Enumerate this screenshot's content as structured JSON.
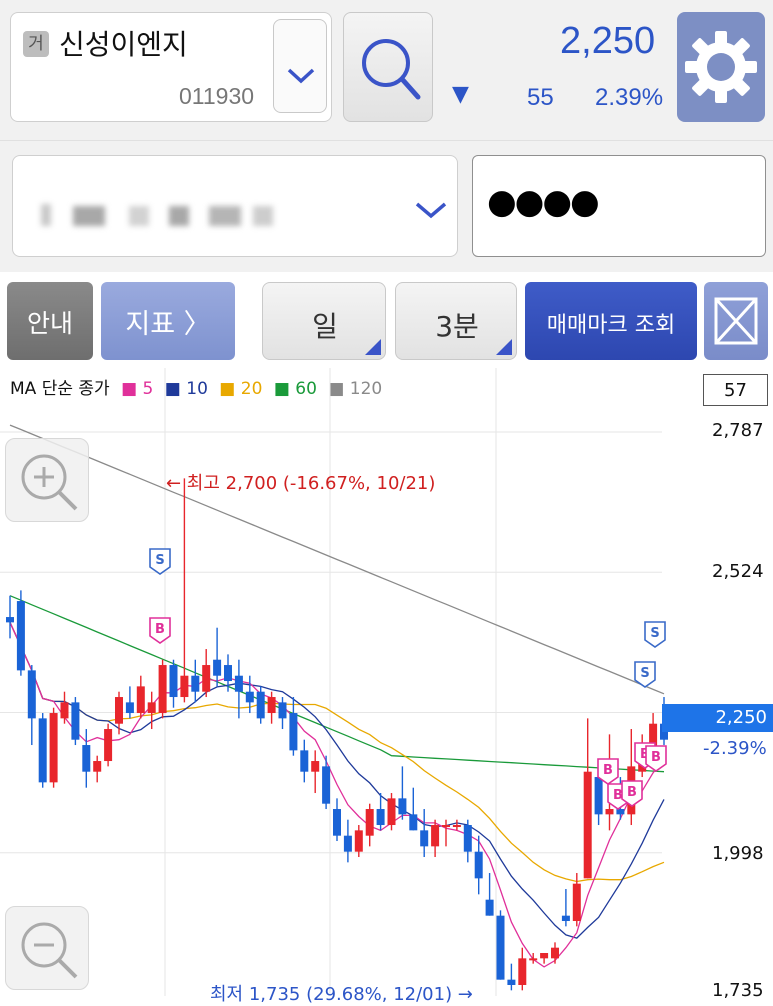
{
  "stock": {
    "market_badge": "거",
    "name": "신성이엔지",
    "code": "011930",
    "price": "2,250",
    "change_arrow": "▼",
    "change": "55",
    "change_pct": "2.39%"
  },
  "account": {
    "password_mask": "●●●●"
  },
  "toolbar": {
    "guide": "안내",
    "indicator": "지표 〉",
    "period": "일",
    "interval": "3분",
    "trade_mark": "매매마크 조회"
  },
  "legend": {
    "prefix": "MA 단순 종가",
    "items": [
      {
        "label": "5",
        "color": "#e0309a"
      },
      {
        "label": "10",
        "color": "#1f3a9a"
      },
      {
        "label": "20",
        "color": "#e8a800"
      },
      {
        "label": "60",
        "color": "#1a9a3a"
      },
      {
        "label": "120",
        "color": "#8a8a8a"
      }
    ],
    "count": "57"
  },
  "colors": {
    "accent": "#3a54c8",
    "up": "#e8262c",
    "down": "#1a63d6",
    "current_price_tag": "#1e74e8"
  },
  "chart_data": {
    "type": "candlestick",
    "y_ticks": [
      "2,787",
      "2,524",
      "1,998",
      "1,735"
    ],
    "ylim": [
      1735,
      2787
    ],
    "current_price": "2,250",
    "current_change": "-2.39%",
    "high_annotation": "← 최고 2,700 (-16.67%, 10/21)",
    "low_annotation": "최저 1,735 (29.68%, 12/01) →",
    "candles": [
      [
        2440,
        2480,
        2400,
        2430
      ],
      [
        2470,
        2490,
        2330,
        2340
      ],
      [
        2340,
        2350,
        2200,
        2250
      ],
      [
        2250,
        2260,
        2120,
        2130
      ],
      [
        2130,
        2270,
        2120,
        2260
      ],
      [
        2250,
        2300,
        2240,
        2280
      ],
      [
        2280,
        2290,
        2200,
        2210
      ],
      [
        2200,
        2230,
        2120,
        2150
      ],
      [
        2150,
        2180,
        2130,
        2170
      ],
      [
        2170,
        2240,
        2160,
        2230
      ],
      [
        2240,
        2300,
        2220,
        2290
      ],
      [
        2280,
        2310,
        2250,
        2260
      ],
      [
        2260,
        2330,
        2250,
        2310
      ],
      [
        2260,
        2300,
        2230,
        2280
      ],
      [
        2260,
        2360,
        2250,
        2350
      ],
      [
        2350,
        2360,
        2270,
        2290
      ],
      [
        2290,
        2700,
        2280,
        2330
      ],
      [
        2330,
        2360,
        2280,
        2300
      ],
      [
        2300,
        2380,
        2290,
        2350
      ],
      [
        2360,
        2420,
        2310,
        2330
      ],
      [
        2350,
        2370,
        2300,
        2320
      ],
      [
        2330,
        2360,
        2250,
        2300
      ],
      [
        2300,
        2330,
        2260,
        2280
      ],
      [
        2300,
        2310,
        2240,
        2250
      ],
      [
        2260,
        2300,
        2240,
        2290
      ],
      [
        2280,
        2290,
        2230,
        2250
      ],
      [
        2260,
        2290,
        2180,
        2190
      ],
      [
        2190,
        2210,
        2130,
        2150
      ],
      [
        2150,
        2190,
        2110,
        2170
      ],
      [
        2160,
        2180,
        2080,
        2090
      ],
      [
        2080,
        2100,
        2020,
        2030
      ],
      [
        2030,
        2060,
        1980,
        2000
      ],
      [
        2000,
        2050,
        1990,
        2040
      ],
      [
        2030,
        2090,
        2010,
        2080
      ],
      [
        2080,
        2110,
        2040,
        2050
      ],
      [
        2050,
        2110,
        2040,
        2100
      ],
      [
        2100,
        2160,
        2060,
        2070
      ],
      [
        2070,
        2120,
        2040,
        2040
      ],
      [
        2040,
        2080,
        1990,
        2010
      ],
      [
        2010,
        2060,
        1990,
        2050
      ],
      [
        2050,
        2060,
        2010,
        2050
      ],
      [
        2050,
        2060,
        2040,
        2050
      ],
      [
        2050,
        2060,
        1980,
        2000
      ],
      [
        2000,
        2030,
        1920,
        1950
      ],
      [
        1910,
        1960,
        1880,
        1880
      ],
      [
        1880,
        1890,
        1760,
        1760
      ],
      [
        1760,
        1790,
        1740,
        1750
      ],
      [
        1750,
        1820,
        1740,
        1800
      ],
      [
        1800,
        1810,
        1790,
        1800
      ],
      [
        1800,
        1810,
        1790,
        1810
      ],
      [
        1800,
        1830,
        1790,
        1820
      ],
      [
        1880,
        1930,
        1860,
        1870
      ],
      [
        1870,
        1960,
        1860,
        1940
      ],
      [
        1950,
        2250,
        1950,
        2150
      ],
      [
        2140,
        2170,
        2050,
        2070
      ],
      [
        2070,
        2220,
        2040,
        2080
      ],
      [
        2080,
        2140,
        2060,
        2070
      ],
      [
        2070,
        2230,
        2050,
        2160
      ],
      [
        2150,
        2220,
        2140,
        2190
      ],
      [
        2190,
        2260,
        2160,
        2240
      ],
      [
        2240,
        2290,
        2200,
        2210
      ]
    ]
  }
}
